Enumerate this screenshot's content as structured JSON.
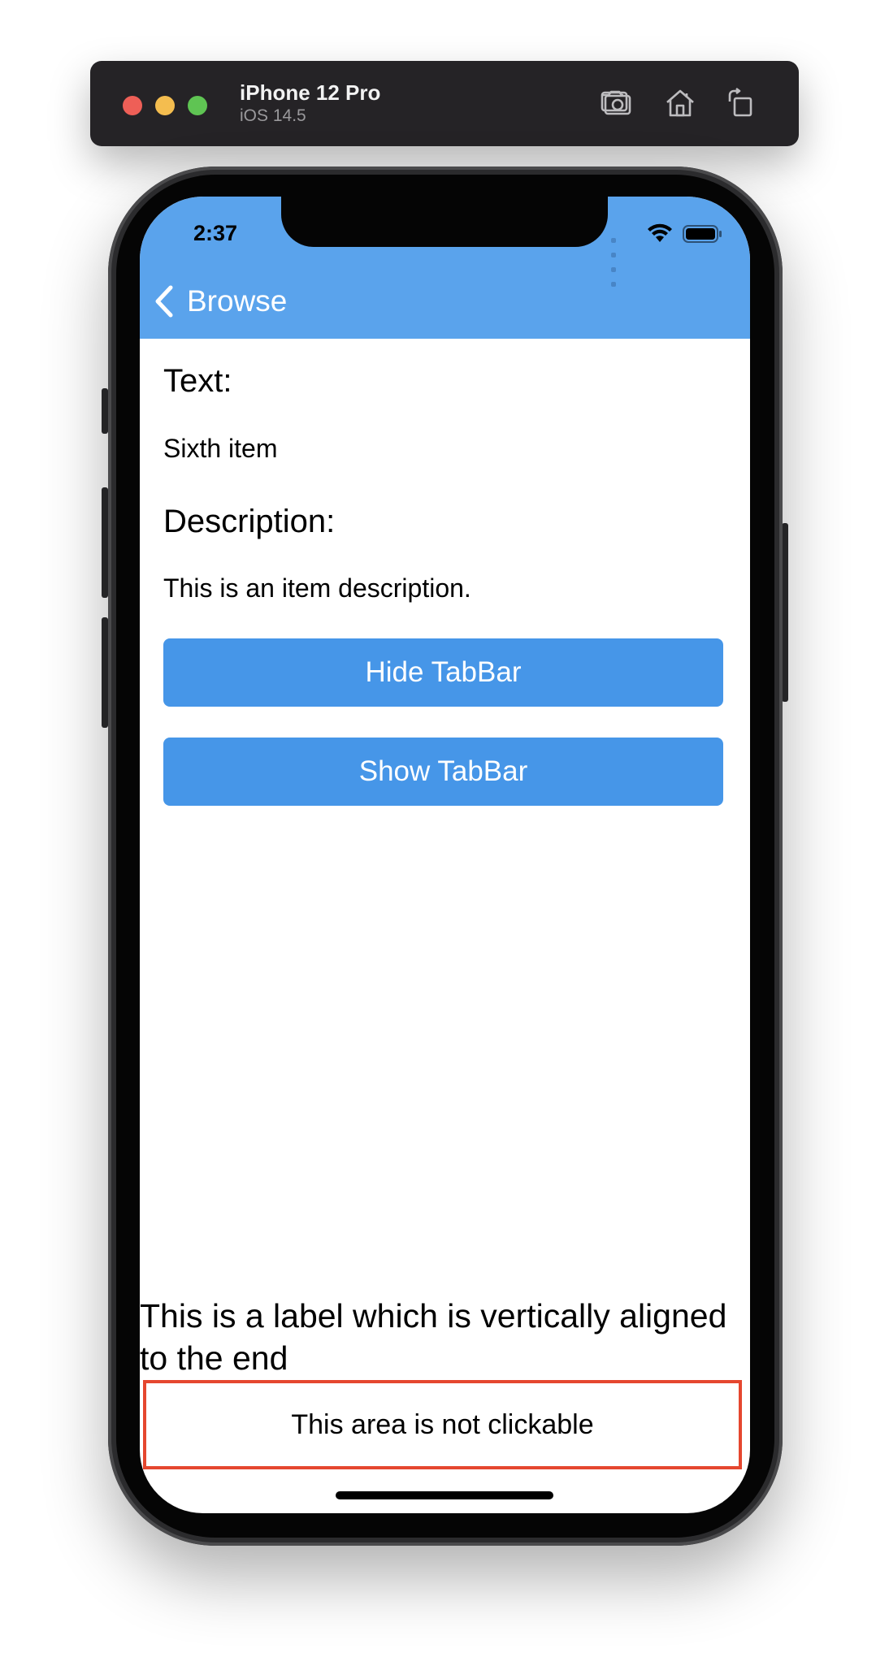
{
  "simulator": {
    "device_name": "iPhone 12 Pro",
    "os_version": "iOS 14.5",
    "toolbar_icons": [
      "screenshot-icon",
      "home-icon",
      "rotate-icon"
    ]
  },
  "status_bar": {
    "time": "2:37",
    "icons": [
      "cellular-signal-icon",
      "wifi-icon",
      "battery-icon"
    ]
  },
  "nav": {
    "back_label": "Browse",
    "back_icon": "chevron-left-icon"
  },
  "detail": {
    "text_heading": "Text:",
    "text_value": "Sixth item",
    "description_heading": "Description:",
    "description_value": "This is an item description."
  },
  "buttons": {
    "hide_tabbar": "Hide TabBar",
    "show_tabbar": "Show TabBar"
  },
  "bottom": {
    "end_label": "This is a label which is vertically aligned to the end",
    "not_clickable_label": "This area is not clickable"
  },
  "colors": {
    "header_background": "#5aa3ec",
    "button_background": "#4696e8",
    "not_clickable_border": "#e5472f"
  }
}
